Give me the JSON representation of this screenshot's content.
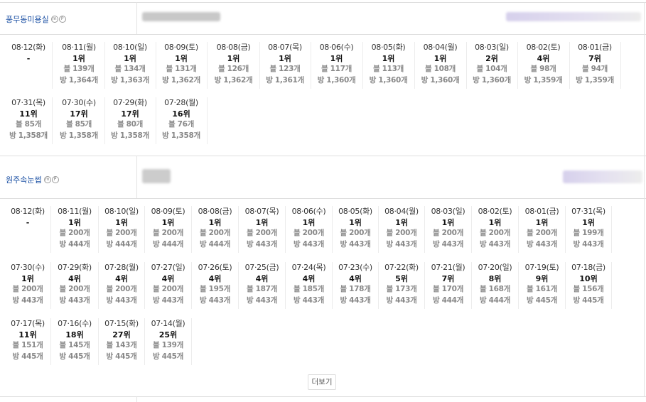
{
  "stores": [
    {
      "name": "풍무동미용실",
      "badges": [
        "m",
        "P"
      ],
      "cells": [
        {
          "date": "08·12(화)",
          "rank": "-",
          "blog": "",
          "place": ""
        },
        {
          "date": "08·11(월)",
          "rank": "1위",
          "blog": "블 139개",
          "place": "방 1,364개"
        },
        {
          "date": "08·10(일)",
          "rank": "1위",
          "blog": "블 134개",
          "place": "방 1,363개"
        },
        {
          "date": "08·09(토)",
          "rank": "1위",
          "blog": "블 131개",
          "place": "방 1,362개"
        },
        {
          "date": "08·08(금)",
          "rank": "1위",
          "blog": "블 126개",
          "place": "방 1,362개"
        },
        {
          "date": "08·07(목)",
          "rank": "1위",
          "blog": "블 123개",
          "place": "방 1,361개"
        },
        {
          "date": "08·06(수)",
          "rank": "1위",
          "blog": "블 117개",
          "place": "방 1,360개"
        },
        {
          "date": "08·05(화)",
          "rank": "1위",
          "blog": "블 113개",
          "place": "방 1,360개"
        },
        {
          "date": "08·04(월)",
          "rank": "1위",
          "blog": "블 108개",
          "place": "방 1,360개"
        },
        {
          "date": "08·03(일)",
          "rank": "2위",
          "blog": "블 104개",
          "place": "방 1,360개"
        },
        {
          "date": "08·02(토)",
          "rank": "4위",
          "blog": "블 98개",
          "place": "방 1,359개"
        },
        {
          "date": "08·01(금)",
          "rank": "7위",
          "blog": "블 94개",
          "place": "방 1,359개"
        },
        {
          "date": "07·31(목)",
          "rank": "11위",
          "blog": "블 85개",
          "place": "방 1,358개"
        },
        {
          "date": "07·30(수)",
          "rank": "17위",
          "blog": "블 85개",
          "place": "방 1,358개"
        },
        {
          "date": "07·29(화)",
          "rank": "17위",
          "blog": "블 80개",
          "place": "방 1,358개"
        },
        {
          "date": "07·28(월)",
          "rank": "16위",
          "blog": "블 76개",
          "place": "방 1,358개"
        }
      ]
    },
    {
      "name": "원주속눈썹",
      "badges": [
        "m",
        "P"
      ],
      "cells": [
        {
          "date": "08·12(화)",
          "rank": "-",
          "blog": "",
          "place": ""
        },
        {
          "date": "08·11(월)",
          "rank": "1위",
          "blog": "블 200개",
          "place": "방 444개"
        },
        {
          "date": "08·10(일)",
          "rank": "1위",
          "blog": "블 200개",
          "place": "방 444개"
        },
        {
          "date": "08·09(토)",
          "rank": "1위",
          "blog": "블 200개",
          "place": "방 444개"
        },
        {
          "date": "08·08(금)",
          "rank": "1위",
          "blog": "블 200개",
          "place": "방 444개"
        },
        {
          "date": "08·07(목)",
          "rank": "1위",
          "blog": "블 200개",
          "place": "방 443개"
        },
        {
          "date": "08·06(수)",
          "rank": "1위",
          "blog": "블 200개",
          "place": "방 443개"
        },
        {
          "date": "08·05(화)",
          "rank": "1위",
          "blog": "블 200개",
          "place": "방 443개"
        },
        {
          "date": "08·04(월)",
          "rank": "1위",
          "blog": "블 200개",
          "place": "방 443개"
        },
        {
          "date": "08·03(일)",
          "rank": "1위",
          "blog": "블 200개",
          "place": "방 443개"
        },
        {
          "date": "08·02(토)",
          "rank": "1위",
          "blog": "블 200개",
          "place": "방 443개"
        },
        {
          "date": "08·01(금)",
          "rank": "1위",
          "blog": "블 200개",
          "place": "방 443개"
        },
        {
          "date": "07·31(목)",
          "rank": "1위",
          "blog": "블 199개",
          "place": "방 443개"
        },
        {
          "date": "07·30(수)",
          "rank": "1위",
          "blog": "블 200개",
          "place": "방 443개"
        },
        {
          "date": "07·29(화)",
          "rank": "4위",
          "blog": "블 200개",
          "place": "방 443개"
        },
        {
          "date": "07·28(월)",
          "rank": "4위",
          "blog": "블 200개",
          "place": "방 443개"
        },
        {
          "date": "07·27(일)",
          "rank": "4위",
          "blog": "블 200개",
          "place": "방 443개"
        },
        {
          "date": "07·26(토)",
          "rank": "4위",
          "blog": "블 195개",
          "place": "방 443개"
        },
        {
          "date": "07·25(금)",
          "rank": "4위",
          "blog": "블 187개",
          "place": "방 443개"
        },
        {
          "date": "07·24(목)",
          "rank": "4위",
          "blog": "블 185개",
          "place": "방 443개"
        },
        {
          "date": "07·23(수)",
          "rank": "4위",
          "blog": "블 178개",
          "place": "방 443개"
        },
        {
          "date": "07·22(화)",
          "rank": "5위",
          "blog": "블 173개",
          "place": "방 443개"
        },
        {
          "date": "07·21(월)",
          "rank": "7위",
          "blog": "블 170개",
          "place": "방 444개"
        },
        {
          "date": "07·20(일)",
          "rank": "8위",
          "blog": "블 168개",
          "place": "방 444개"
        },
        {
          "date": "07·19(토)",
          "rank": "9위",
          "blog": "블 161개",
          "place": "방 445개"
        },
        {
          "date": "07·18(금)",
          "rank": "10위",
          "blog": "블 156개",
          "place": "방 445개"
        },
        {
          "date": "07·17(목)",
          "rank": "11위",
          "blog": "블 151개",
          "place": "방 445개"
        },
        {
          "date": "07·16(수)",
          "rank": "18위",
          "blog": "블 145개",
          "place": "방 445개"
        },
        {
          "date": "07·15(화)",
          "rank": "27위",
          "blog": "블 143개",
          "place": "방 445개"
        },
        {
          "date": "07·14(월)",
          "rank": "25위",
          "blog": "블 139개",
          "place": "방 445개"
        }
      ]
    }
  ],
  "more_button": "더보기"
}
